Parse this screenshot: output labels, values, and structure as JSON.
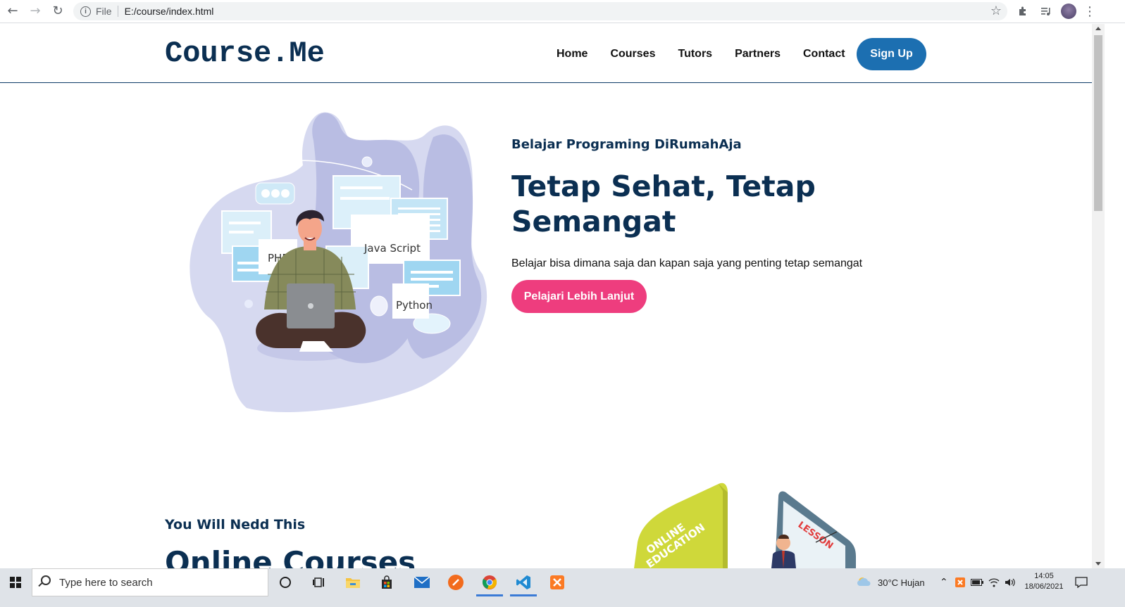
{
  "browser": {
    "file_label": "File",
    "url": "E:/course/index.html"
  },
  "header": {
    "logo": "Course.Me",
    "nav": [
      "Home",
      "Courses",
      "Tutors",
      "Partners",
      "Contact"
    ],
    "signup_label": "Sign Up"
  },
  "hero": {
    "subtitle": "Belajar Programing DiRumahAja",
    "title": "Tetap Sehat, Tetap Semangat",
    "description": "Belajar bisa dimana saja dan kapan saja yang penting tetap semangat",
    "cta_label": "Pelajari Lebih Lanjut",
    "illustration_labels": {
      "php": "PHP",
      "javascript": "Java Script",
      "python": "Python"
    }
  },
  "section2": {
    "subtitle": "You Will Nedd This",
    "title": "Online Courses",
    "illustration_labels": {
      "online": "ONLINE",
      "education": "EDUCATION",
      "lesson": "LESSON"
    }
  },
  "taskbar": {
    "search_placeholder": "Type here to search",
    "weather": "30°C  Hujan",
    "time": "14:05",
    "date": "18/06/2021"
  },
  "colors": {
    "brand_navy": "#0b2f52",
    "signup_blue": "#1c6fb1",
    "cta_pink": "#ee3d7e"
  }
}
